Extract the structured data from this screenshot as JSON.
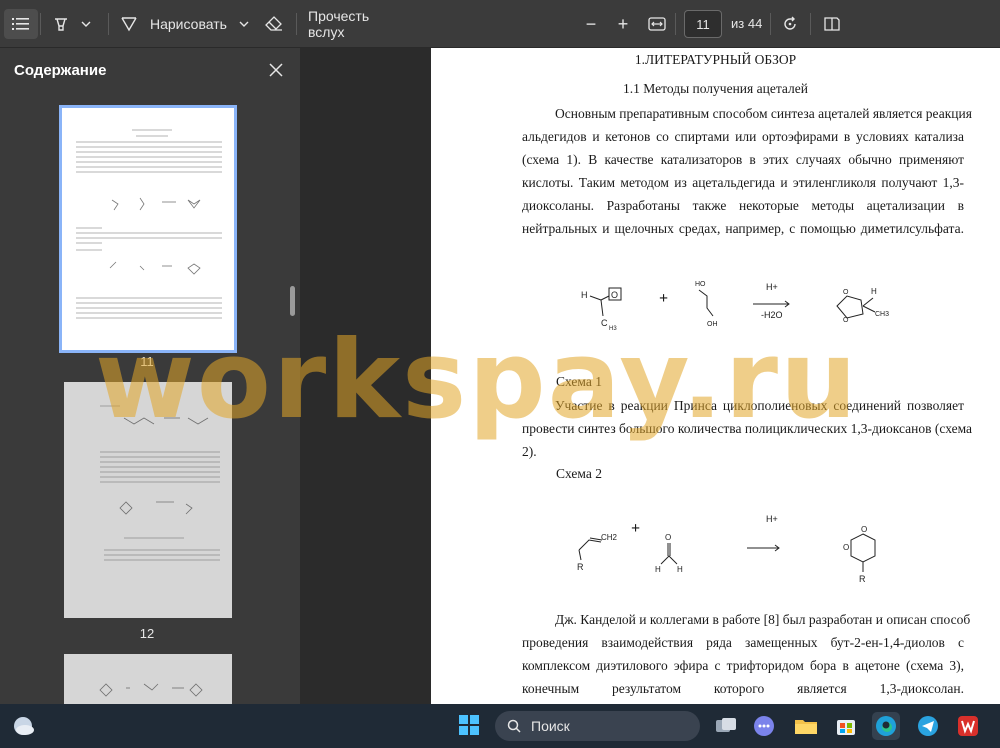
{
  "toolbar": {
    "draw_label": "Нарисовать",
    "read_aloud_label": "Прочесть вслух",
    "minus_symbol": "−",
    "plus_symbol": "+",
    "current_page": "11",
    "total_pages": "из 44"
  },
  "sidebar": {
    "title": "Содержание",
    "thumbnails": [
      {
        "label": "11"
      },
      {
        "label": "12"
      }
    ]
  },
  "document": {
    "heading": "1.ЛИТЕРАТУРНЫЙ ОБЗОР",
    "subheading": "1.1 Методы получения ацеталей",
    "paragraph1": [
      "Основным препаративным способом синтеза ацеталей является реакция",
      "альдегидов и кетонов со спиртами или ортоэфирами в условиях катализа",
      "(схема 1). В качестве катализаторов в этих случаях обычно применяют",
      "кислоты. Таким методом из ацетальдегида и этиленгликоля получают 1,3-",
      "диоксоланы. Разработаны также некоторые методы ацетализации в",
      "нейтральных и щелочных средах, например, с помощью диметилсульфата."
    ],
    "scheme1_label": "Схема 1",
    "paragraph2": [
      "Участие в реакции Принса циклополиеновых соединений позволяет",
      "провести синтез большого количества полициклических 1,3-диоксанов (схема",
      "2)."
    ],
    "scheme2_label": "Схема 2",
    "paragraph3": [
      "Дж. Канделой и коллегами в работе [8] был разработан и описан способ",
      "проведения взаимодействия ряда замещенных бут-2-ен-1,4-диолов с",
      "комплексом диэтилового эфира с трифторидом бора в ацетоне (схема 3),",
      "конечным результатом которого является 1,3-диоксолан."
    ],
    "scheme1": {
      "catalyst": "H+",
      "byproduct": "-H2O",
      "plus": "+"
    },
    "scheme2": {
      "catalyst": "H+",
      "plus": "+"
    }
  },
  "watermark": "workspay.ru",
  "taskbar": {
    "search_placeholder": "Поиск"
  }
}
